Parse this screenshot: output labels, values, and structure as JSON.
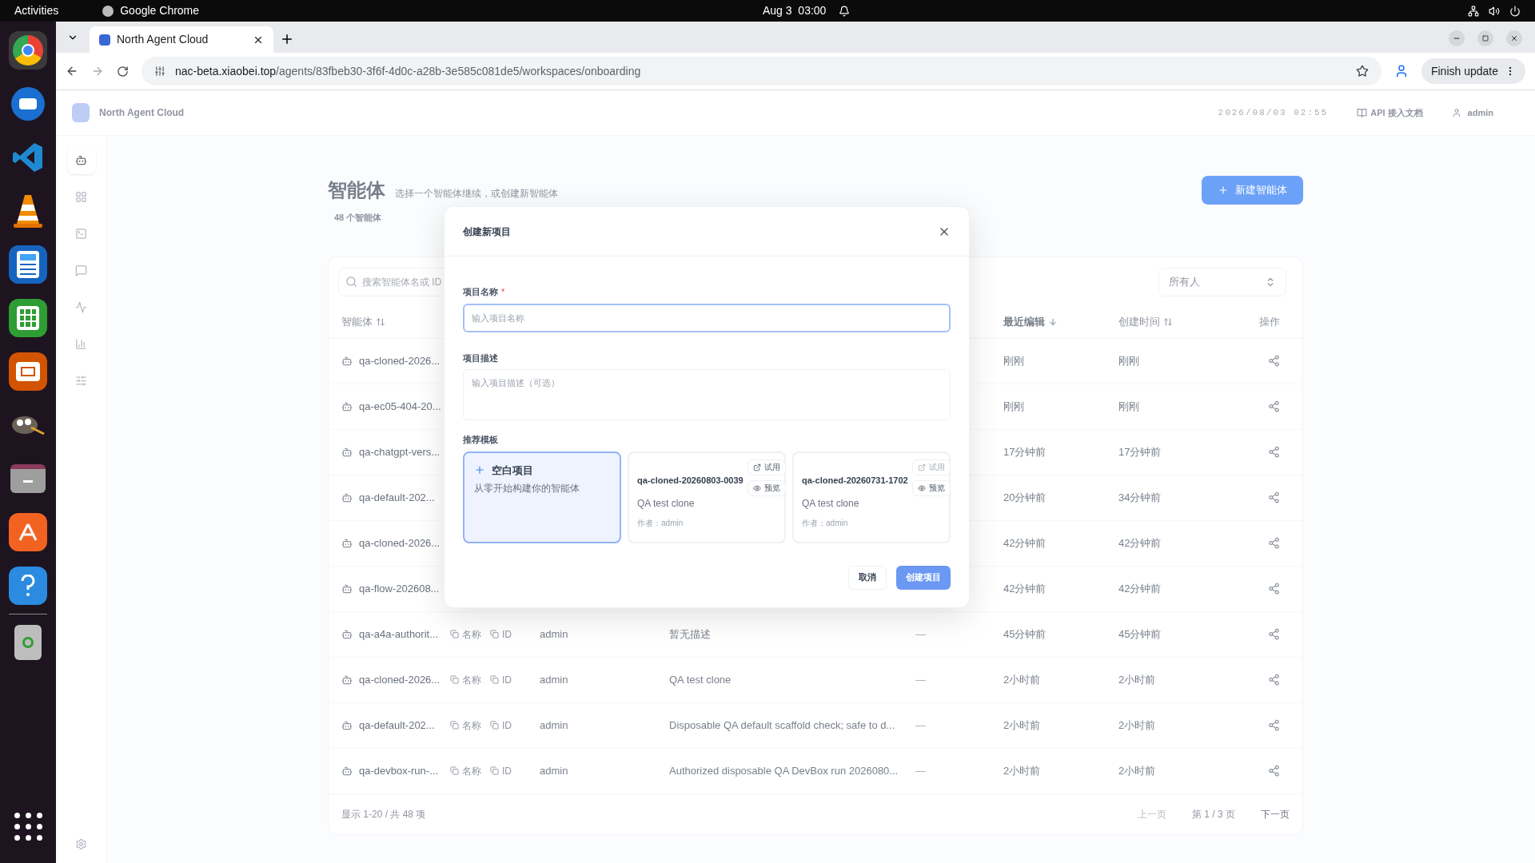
{
  "system_bar": {
    "activities": "Activities",
    "app": "Google Chrome",
    "clock": "Aug 3  03:00"
  },
  "browser": {
    "tab": {
      "title": "North Agent Cloud"
    },
    "url_host": "nac-beta.xiaobei.top",
    "url_path": "/agents/83fbeb30-3f6f-4d0c-a28b-3e585c081de5/workspaces/onboarding",
    "update_button": "Finish update"
  },
  "header": {
    "brand": "North Agent Cloud",
    "timestamp": "2026/08/03 02:55",
    "docs_link": "API 接入文档",
    "user": "admin"
  },
  "sidebar": {
    "items": [
      {
        "selected": true
      },
      {
        "selected": false
      },
      {
        "selected": false
      },
      {
        "selected": false
      },
      {
        "selected": false
      },
      {
        "selected": false
      },
      {
        "selected": false
      }
    ]
  },
  "page": {
    "title": "智能体",
    "subtitle": "选择一个智能体继续，或创建新智能体",
    "count": "48 个智能体",
    "new_button": "新建智能体"
  },
  "table": {
    "search_placeholder": "搜索智能体名或 ID",
    "owner_filter": "所有人",
    "columns": [
      {
        "label": "智能体",
        "sortable": true,
        "sorted": false
      },
      {
        "label": "最近编辑",
        "sortable": true,
        "sorted": true
      },
      {
        "label": "创建时间",
        "sortable": true,
        "sorted": false
      },
      {
        "label": "操作",
        "sortable": false,
        "sorted": false
      }
    ],
    "rows": [
      {
        "name": "qa-cloned-2026...",
        "edited": "刚刚",
        "created": "刚刚"
      },
      {
        "name": "qa-ec05-404-20...",
        "edited": "刚刚",
        "created": "刚刚"
      },
      {
        "name": "qa-chatgpt-vers...",
        "edited": "17分钟前",
        "created": "17分钟前"
      },
      {
        "name": "qa-default-202...",
        "edited": "20分钟前",
        "created": "34分钟前"
      },
      {
        "name": "qa-cloned-2026...",
        "edited": "42分钟前",
        "created": "42分钟前"
      },
      {
        "name": "qa-flow-202608...",
        "edited": "42分钟前",
        "created": "42分钟前"
      },
      {
        "name": "qa-a4a-authorit...",
        "copy_name": "名称",
        "copy_id": "ID",
        "owner": "admin",
        "description": "暂无描述",
        "type": "—",
        "edited": "45分钟前",
        "created": "45分钟前"
      },
      {
        "name": "qa-cloned-2026...",
        "copy_name": "名称",
        "copy_id": "ID",
        "owner": "admin",
        "description": "QA test clone",
        "type": "—",
        "edited": "2小时前",
        "created": "2小时前"
      },
      {
        "name": "qa-default-202...",
        "copy_name": "名称",
        "copy_id": "ID",
        "owner": "admin",
        "description": "Disposable QA default scaffold check; safe to d...",
        "type": "—",
        "edited": "2小时前",
        "created": "2小时前"
      },
      {
        "name": "qa-devbox-run-...",
        "copy_name": "名称",
        "copy_id": "ID",
        "owner": "admin",
        "description": "Authorized disposable QA DevBox run 2026080...",
        "type": "—",
        "edited": "2小时前",
        "created": "2小时前"
      }
    ],
    "pagination": {
      "summary": "显示 1-20 / 共 48 项",
      "prev": "上一页",
      "prev_disabled": true,
      "page": "第 1 / 3 页",
      "next": "下一页",
      "next_disabled": false
    }
  },
  "dialog": {
    "title": "创建新项目",
    "name_label": "项目名称",
    "name_required": "*",
    "name_placeholder": "输入项目名称",
    "desc_label": "项目描述",
    "desc_placeholder": "输入项目描述（可选）",
    "templates_label": "推荐模板",
    "templates": [
      {
        "kind": "blank",
        "title": "空白项目",
        "description": "从零开始构建你的智能体",
        "selected": true
      },
      {
        "kind": "template",
        "title": "qa-cloned-20260803-0039",
        "try": "试用",
        "preview": "预览",
        "description": "QA test clone",
        "author": "作者：admin",
        "selected": false,
        "try_disabled": false
      },
      {
        "kind": "template",
        "title": "qa-cloned-20260731-1702",
        "try": "试用",
        "preview": "预览",
        "description": "QA test clone",
        "author": "作者：admin",
        "selected": false,
        "try_disabled": true
      }
    ],
    "cancel": "取消",
    "submit": "创建项目"
  }
}
